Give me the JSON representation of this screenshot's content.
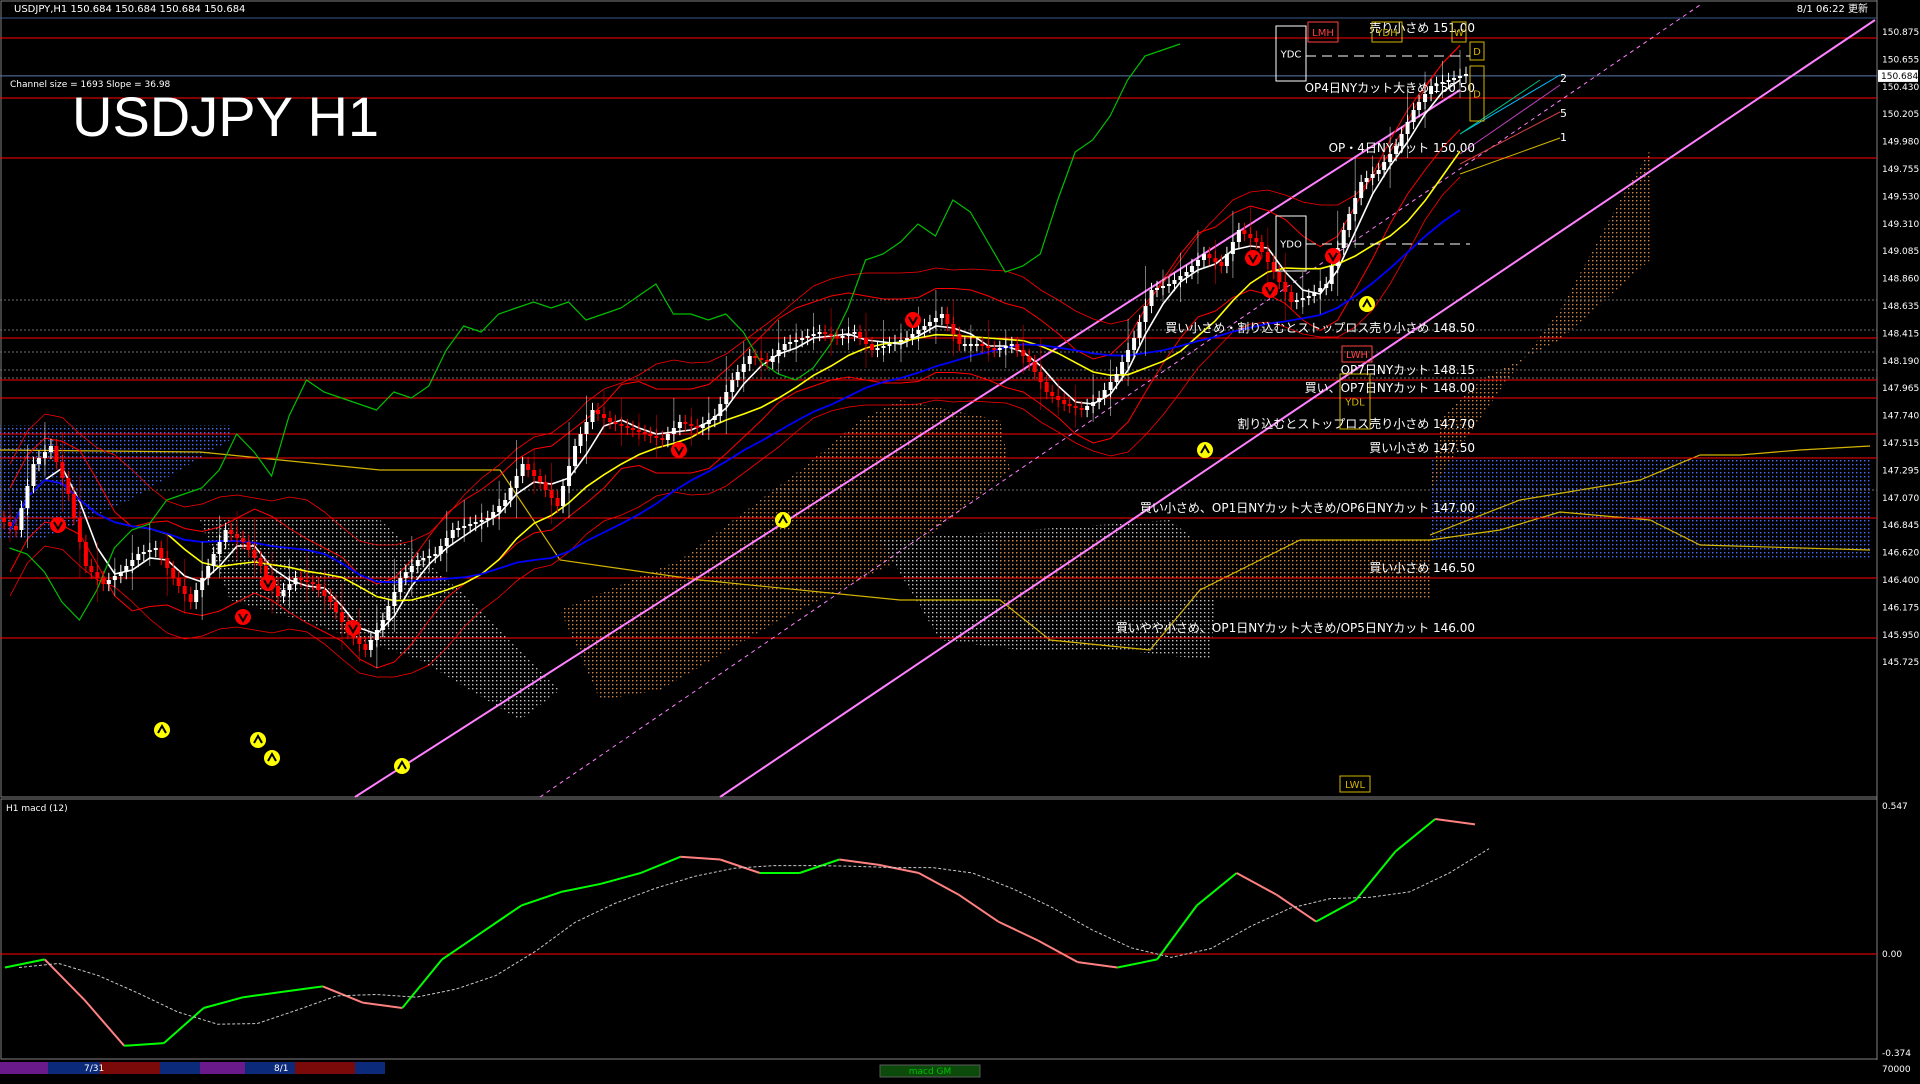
{
  "header": {
    "symbol_line": "USDJPY,H1  150.684 150.684 150.684 150.684",
    "timestamp": "8/1 06:22 更新",
    "channel_info": "Channel size = 1693 Slope = 36.98",
    "chart_title": "USDJPY H1"
  },
  "price_axis": {
    "current_price": "150.684",
    "labels": [
      "150.875",
      "150.655",
      "150.430",
      "150.205",
      "149.980",
      "149.755",
      "149.530",
      "149.310",
      "149.085",
      "148.860",
      "148.635",
      "148.415",
      "148.190",
      "147.965",
      "147.740",
      "147.515",
      "147.295",
      "147.070",
      "146.845",
      "146.620",
      "146.400",
      "146.175",
      "145.950",
      "145.725"
    ]
  },
  "levels": [
    {
      "label": "売り小さめ 151.00",
      "price": 151.0
    },
    {
      "label": "OP4日NYカット大きめ 150.50",
      "price": 150.5
    },
    {
      "label": "OP・4日NYカット 150.00",
      "price": 150.0
    },
    {
      "label": "買い小さめ・割り込むとストップロス売り小さめ 148.50",
      "price": 148.5
    },
    {
      "label": "OP7日NYカット 148.15",
      "price": 148.15
    },
    {
      "label": "買い、OP7日NYカット 148.00",
      "price": 148.0
    },
    {
      "label": "割り込むとストップロス売り小さめ 147.70",
      "price": 147.7
    },
    {
      "label": "買い小さめ 147.50",
      "price": 147.5
    },
    {
      "label": "買い小さめ、OP1日NYカット大きめ/OP6日NYカット 147.00",
      "price": 147.0
    },
    {
      "label": "買い小さめ 146.50",
      "price": 146.5
    },
    {
      "label": "買いやや小さめ、OP1日NYカット大きめ/OP5日NYカット 146.00",
      "price": 146.0
    }
  ],
  "marker_boxes": {
    "ydc": "YDC",
    "ydo": "YDO",
    "ydh": "YDH",
    "ydl": "YDL",
    "lmh": "LMH",
    "lwh": "LWH",
    "lwl": "LWL",
    "w": "W",
    "d1": "D",
    "d2": "D"
  },
  "projection_labels": [
    "2",
    "5",
    "1"
  ],
  "macd": {
    "title": "H1  macd (12)",
    "axis_labels": [
      "0.547",
      "0.00",
      "-0.374"
    ],
    "indicator_tag": "macd GM"
  },
  "timeline": {
    "date_labels": [
      "7/31",
      "8/1"
    ],
    "right_label": "70000"
  },
  "colors": {
    "up_candle": "#ffffff",
    "down_candle": "#ff0000",
    "level_line": "#ff0000",
    "channel": "#ff80ff",
    "sma_fast": "#ffffff",
    "sma_mid": "#ffff00",
    "sma_slow": "#0000ff",
    "chikou": "#00c000",
    "bollinger": "#ff0000",
    "macd_up": "#00ff00",
    "macd_down": "#ff8080",
    "signal": "#c8c8c8"
  },
  "chart_data": {
    "type": "candlestick",
    "symbol": "USDJPY",
    "timeframe": "H1",
    "y_range_price": [
      145.725,
      151.1
    ],
    "close_path": [
      146.9,
      147.45,
      147.6,
      147.2,
      146.6,
      146.45,
      146.55,
      146.7,
      146.75,
      146.5,
      146.3,
      146.6,
      146.9,
      146.8,
      146.6,
      146.35,
      146.5,
      146.45,
      146.3,
      146.05,
      145.9,
      146.15,
      146.5,
      146.65,
      146.7,
      146.9,
      146.95,
      147.0,
      147.15,
      147.45,
      147.3,
      147.1,
      147.6,
      147.9,
      147.8,
      147.75,
      147.7,
      147.65,
      147.8,
      147.75,
      147.85,
      148.15,
      148.35,
      148.3,
      148.45,
      148.5,
      148.55,
      148.5,
      148.55,
      148.4,
      148.45,
      148.5,
      148.6,
      148.7,
      148.45,
      148.45,
      148.4,
      148.45,
      148.3,
      148.05,
      147.95,
      147.9,
      148.0,
      148.2,
      148.5,
      148.9,
      148.95,
      149.05,
      149.2,
      149.1,
      149.4,
      149.3,
      149.05,
      148.8,
      148.85,
      148.95,
      149.4,
      149.8,
      149.9,
      150.1,
      150.4,
      150.6,
      150.65,
      150.7
    ],
    "macd_path": [
      -0.05,
      -0.02,
      -0.17,
      -0.34,
      -0.33,
      -0.2,
      -0.16,
      -0.14,
      -0.12,
      -0.18,
      -0.2,
      -0.02,
      0.08,
      0.18,
      0.23,
      0.26,
      0.3,
      0.36,
      0.35,
      0.3,
      0.3,
      0.35,
      0.33,
      0.3,
      0.22,
      0.12,
      0.05,
      -0.03,
      -0.05,
      -0.02,
      0.18,
      0.3,
      0.22,
      0.12,
      0.2,
      0.38,
      0.5,
      0.48
    ]
  }
}
